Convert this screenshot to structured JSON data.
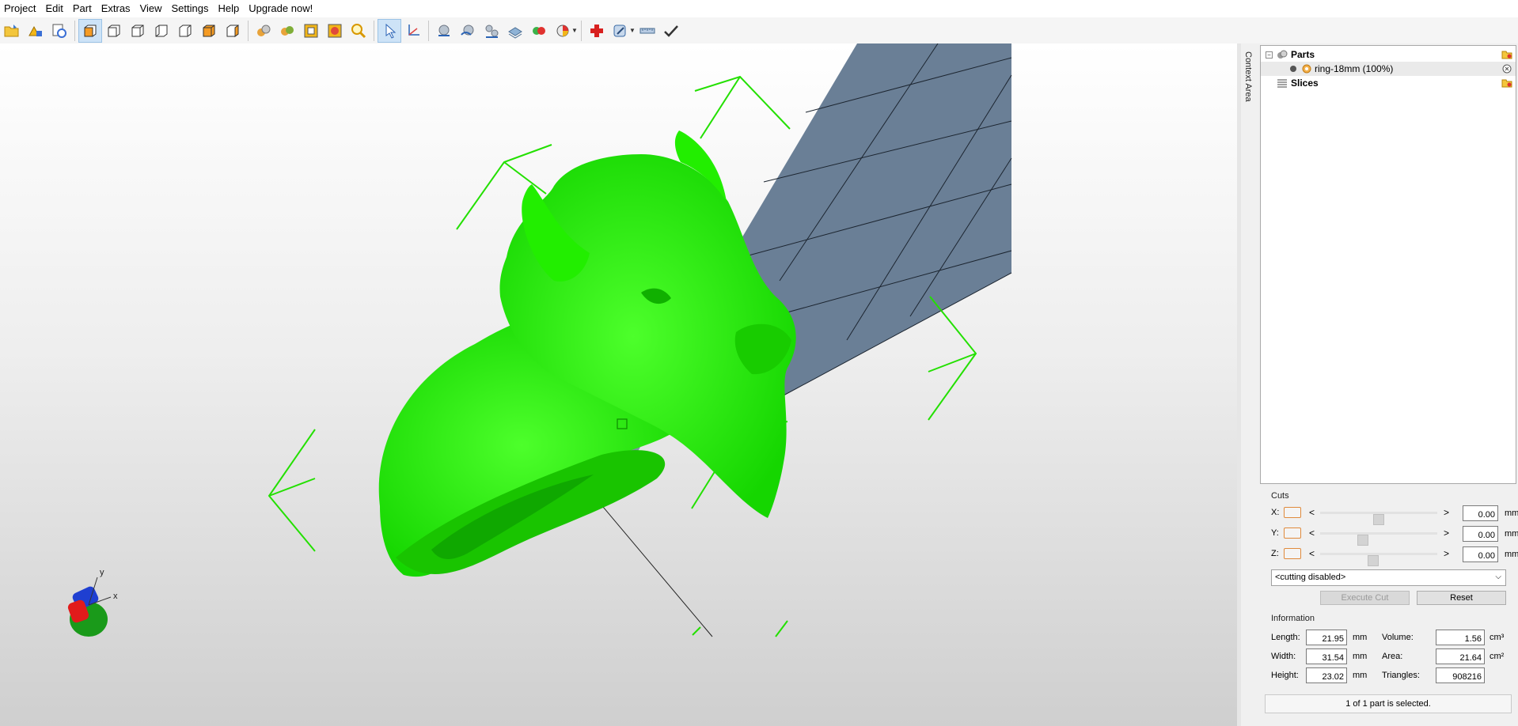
{
  "menu": [
    "Project",
    "Edit",
    "Part",
    "Extras",
    "View",
    "Settings",
    "Help",
    "Upgrade now!"
  ],
  "toolbar": {
    "groups": [
      [
        "open-project-icon",
        "add-part-icon",
        "fabbproject-icon"
      ],
      [
        "view-3d-icon",
        "view-front-icon",
        "view-back-icon",
        "view-left-icon",
        "view-right-icon",
        "view-top-icon",
        "view-bottom-icon"
      ],
      [
        "render-mode-icon",
        "shaded-mode-icon",
        "wireframe-mode-icon",
        "mode-overlay-icon",
        "zoom-icon"
      ],
      [
        "select-arrow-icon",
        "move-axis-icon"
      ],
      [
        "part-sphere-icon",
        "rotate-sphere-icon",
        "measure-icon",
        "layer-icon",
        "boolean-icon",
        "pie-chart-icon"
      ],
      [
        "add-cross-icon",
        "wizard-icon",
        "ruler-icon",
        "checkmark-icon"
      ]
    ]
  },
  "viewport": {
    "mesh_color": "#22ee00",
    "cut_plane_color": "#6a7f96",
    "axes": {
      "x": "x",
      "y": "y"
    }
  },
  "side_tab": {
    "label": "Context Area"
  },
  "tree": {
    "parts_label": "Parts",
    "part_item": "ring-18mm (100%)",
    "slices_label": "Slices"
  },
  "cuts": {
    "title": "Cuts",
    "rows": [
      {
        "axis": "X:",
        "value": "0.00",
        "unit": "mm",
        "slider": 0.5
      },
      {
        "axis": "Y:",
        "value": "0.00",
        "unit": "mm",
        "slider": 0.35
      },
      {
        "axis": "Z:",
        "value": "0.00",
        "unit": "mm",
        "slider": 0.45
      }
    ],
    "less": "<",
    "greater": ">",
    "mode": "<cutting disabled>",
    "execute_label": "Execute Cut",
    "reset_label": "Reset"
  },
  "info": {
    "title": "Information",
    "length_label": "Length:",
    "length": "21.95",
    "width_label": "Width:",
    "width": "31.54",
    "height_label": "Height:",
    "height": "23.02",
    "mm": "mm",
    "volume_label": "Volume:",
    "volume": "1.56",
    "volume_unit": "cm³",
    "area_label": "Area:",
    "area": "21.64",
    "area_unit": "cm²",
    "triangles_label": "Triangles:",
    "triangles": "908216"
  },
  "status": "1 of 1 part is selected."
}
